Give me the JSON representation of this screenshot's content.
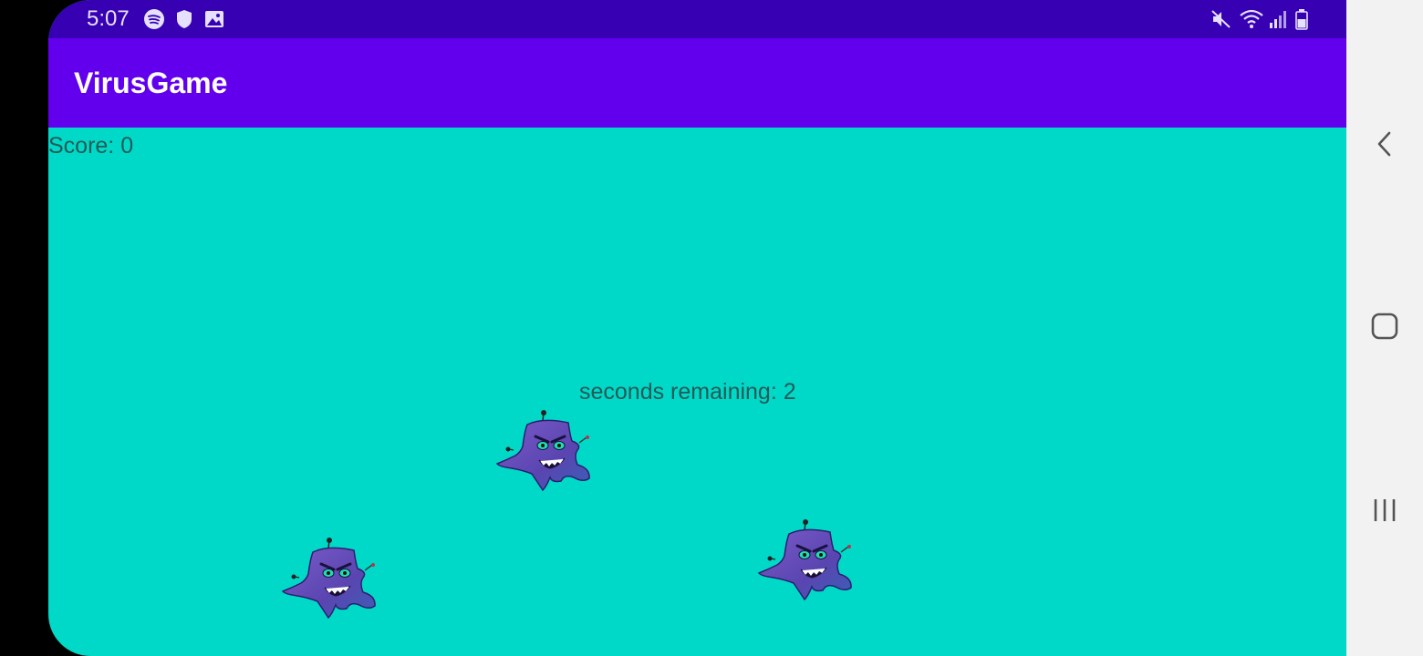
{
  "status_bar": {
    "time": "5:07",
    "left_icons": [
      "spotify-icon",
      "shield-icon",
      "image-icon"
    ],
    "right_icons": [
      "mute-icon",
      "wifi-icon",
      "signal-icon",
      "battery-icon"
    ]
  },
  "app_bar": {
    "title": "VirusGame"
  },
  "game": {
    "score_text": "Score: 0",
    "timer_text": "seconds remaining: 2",
    "virus_count": 3
  },
  "colors": {
    "status_bar": "#3700b3",
    "app_bar": "#6200ee",
    "game_background": "#00d9c8",
    "virus_body": "#6a4fb8"
  },
  "nav_bar": {
    "buttons": [
      "back-icon",
      "home-icon",
      "recents-icon"
    ]
  }
}
